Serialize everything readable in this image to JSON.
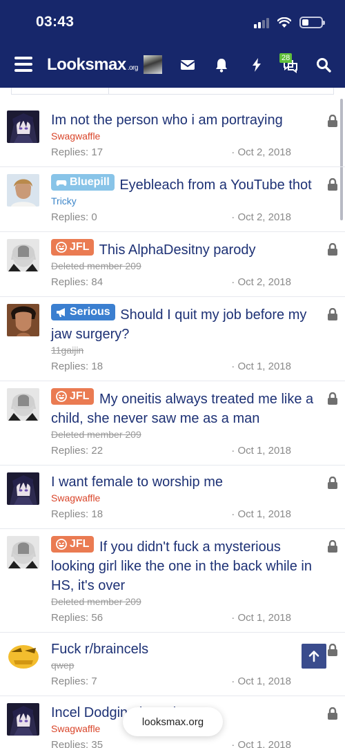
{
  "status_bar": {
    "time": "03:43"
  },
  "nav": {
    "logo": "Looksmax",
    "logo_suffix": ".org",
    "conversations_badge": "28"
  },
  "colors": {
    "header_bg": "#17276b",
    "title_link": "#1d3175",
    "author_red": "#d9452a",
    "author_blue": "#3d86c9",
    "prefix_bluepill": "#88c4e8",
    "prefix_jfl": "#ea7b52",
    "prefix_serious": "#3b7fd0"
  },
  "threads": [
    {
      "prefix": "",
      "title": "Im not the person who i am portraying",
      "author": "Swagwaffle",
      "author_style": "red",
      "replies": "Replies: 17",
      "date": "· Oct 2, 2018",
      "avatar": "anime-avatar",
      "locked": true
    },
    {
      "prefix": "Bluepill",
      "title": "Eyebleach from a YouTube thot",
      "author": "Tricky",
      "author_style": "blue",
      "replies": "Replies: 0",
      "date": "· Oct 2, 2018",
      "avatar": "photo-avatar",
      "locked": true
    },
    {
      "prefix": "JFL",
      "title": "This AlphaDesitny parody",
      "author": "Deleted member 209",
      "author_style": "struck",
      "replies": "Replies: 84",
      "date": "· Oct 2, 2018",
      "avatar": "marx-avatar",
      "locked": true
    },
    {
      "prefix": "Serious",
      "title": "Should I quit my job before my jaw surgery?",
      "author": "11gaijin",
      "author_style": "struck",
      "replies": "Replies: 18",
      "date": "· Oct 1, 2018",
      "avatar": "face-avatar",
      "locked": true
    },
    {
      "prefix": "JFL",
      "title": "My oneitis always treated me like a child, she never saw me as a man",
      "author": "Deleted member 209",
      "author_style": "struck",
      "replies": "Replies: 22",
      "date": "· Oct 1, 2018",
      "avatar": "marx-avatar",
      "locked": true
    },
    {
      "prefix": "",
      "title": "I want female to worship me",
      "author": "Swagwaffle",
      "author_style": "red",
      "replies": "Replies: 18",
      "date": "· Oct 1, 2018",
      "avatar": "anime-avatar",
      "locked": true
    },
    {
      "prefix": "JFL",
      "title": "If you didn't fuck a mysterious looking girl like the one in the back while in HS, it's over",
      "author": "Deleted member 209",
      "author_style": "struck",
      "replies": "Replies: 56",
      "date": "· Oct 1, 2018",
      "avatar": "marx-avatar",
      "locked": true
    },
    {
      "prefix": "",
      "title": "Fuck r/braincels",
      "author": "qwep",
      "author_style": "struck",
      "replies": "Replies: 7",
      "date": "· Oct 1, 2018",
      "avatar": "emoji-avatar",
      "locked": true
    },
    {
      "prefix": "",
      "title": "Incel Dodging is real",
      "author": "Swagwaffle",
      "author_style": "red",
      "replies": "Replies: 35",
      "date": "· Oct 1, 2018",
      "avatar": "anime-avatar",
      "locked": true
    }
  ],
  "browser": {
    "domain": "looksmax.org"
  }
}
